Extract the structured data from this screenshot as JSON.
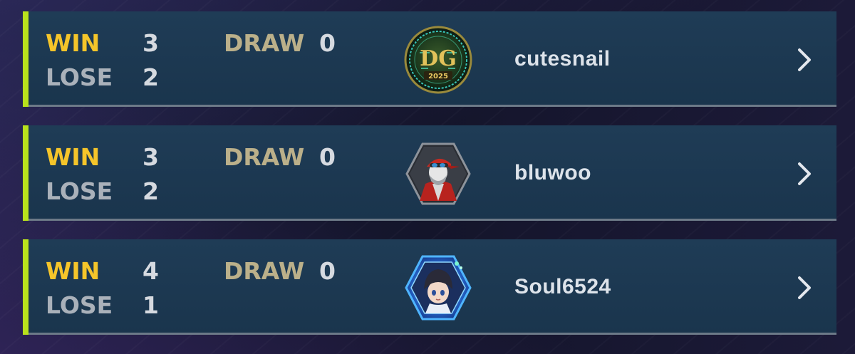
{
  "labels": {
    "win": "WIN",
    "lose": "LOSE",
    "draw": "DRAW"
  },
  "players": [
    {
      "name": "cutesnail",
      "win": "3",
      "lose": "2",
      "draw": "0",
      "avatar": "dg-2025-emblem-icon",
      "avatar_text": "2025"
    },
    {
      "name": "bluwoo",
      "win": "3",
      "lose": "2",
      "draw": "0",
      "avatar": "red-cap-character-icon"
    },
    {
      "name": "Soul6524",
      "win": "4",
      "lose": "1",
      "draw": "0",
      "avatar": "blue-hex-character-icon"
    }
  ],
  "colors": {
    "win": "#f5c52a",
    "lose": "#aab1ba",
    "draw": "#bbb08a",
    "accent_bar": "#b9e21c",
    "row_bg": "#1f3c56"
  }
}
